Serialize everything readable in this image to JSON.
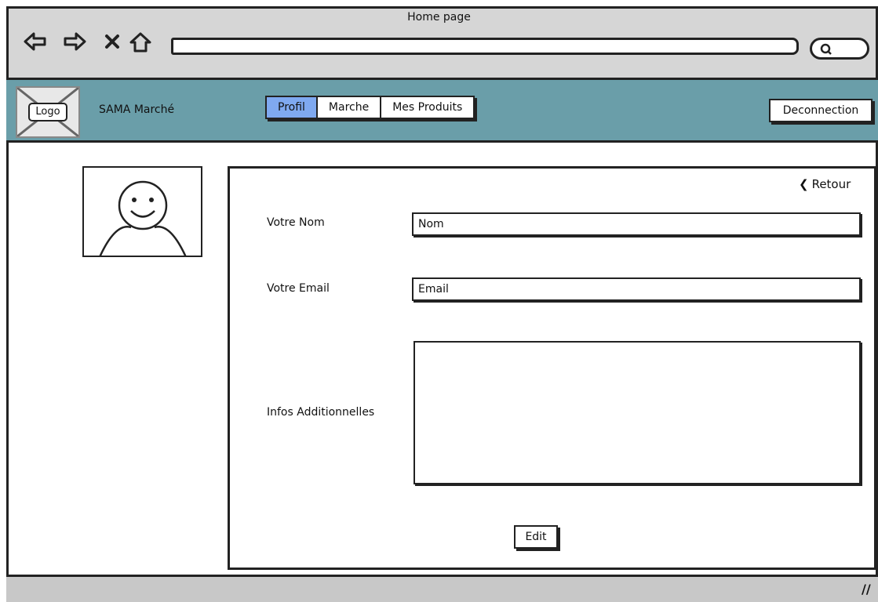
{
  "browser": {
    "title": "Home page",
    "url_value": ""
  },
  "app": {
    "logo_text": "Logo",
    "brand": "SAMA Marché",
    "tabs": [
      {
        "label": "Profil",
        "active": true
      },
      {
        "label": "Marche",
        "active": false
      },
      {
        "label": "Mes Produits",
        "active": false
      }
    ],
    "logout_label": "Deconnection"
  },
  "profile": {
    "back_label": "Retour",
    "name_label": "Votre Nom",
    "name_value": "Nom",
    "email_label": "Votre Email",
    "email_value": "Email",
    "info_label": "Infos Additionnelles",
    "info_value": "",
    "edit_label": "Edit"
  },
  "icons": [
    "back-arrow-icon",
    "forward-arrow-icon",
    "close-icon",
    "home-icon",
    "search-icon",
    "avatar-placeholder-icon",
    "resize-grip-icon"
  ],
  "colors": {
    "appbar": "#6a9ea9",
    "active_tab": "#7fa9f0",
    "chrome": "#d6d6d6"
  }
}
